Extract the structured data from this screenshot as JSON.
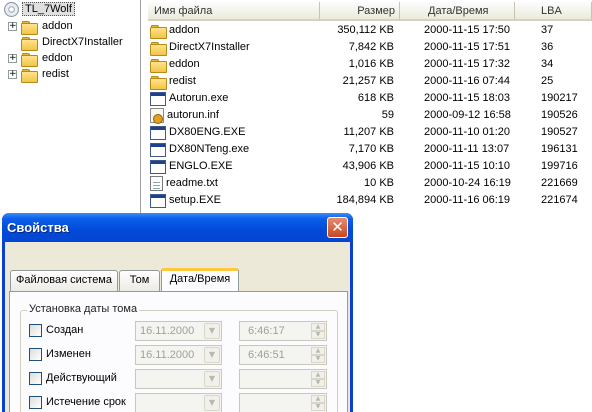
{
  "tree": {
    "root": "TL_7Wolf",
    "items": [
      {
        "label": "addon",
        "expandable": true
      },
      {
        "label": "DirectX7Installer",
        "expandable": false
      },
      {
        "label": "eddon",
        "expandable": true
      },
      {
        "label": "redist",
        "expandable": true
      }
    ],
    "expander_glyph": "+"
  },
  "list": {
    "columns": {
      "name": "Имя файла",
      "size": "Размер",
      "date": "Дата/Время",
      "lba": "LBA"
    },
    "rows": [
      {
        "icon": "folder-icon",
        "name": "addon",
        "size": "350,112 KB",
        "date": "2000-11-15 17:50",
        "lba": "37"
      },
      {
        "icon": "folder-icon",
        "name": "DirectX7Installer",
        "size": "7,842 KB",
        "date": "2000-11-15 17:51",
        "lba": "36"
      },
      {
        "icon": "folder-icon",
        "name": "eddon",
        "size": "1,016 KB",
        "date": "2000-11-15 17:32",
        "lba": "34"
      },
      {
        "icon": "folder-icon",
        "name": "redist",
        "size": "21,257 KB",
        "date": "2000-11-16 07:44",
        "lba": "25"
      },
      {
        "icon": "exe-icon",
        "name": "Autorun.exe",
        "size": "618 KB",
        "date": "2000-11-15 18:03",
        "lba": "190217"
      },
      {
        "icon": "inf-icon",
        "name": "autorun.inf",
        "size": "59",
        "date": "2000-09-12 16:58",
        "lba": "190526"
      },
      {
        "icon": "exe-icon",
        "name": "DX80ENG.EXE",
        "size": "11,207 KB",
        "date": "2000-11-10 01:20",
        "lba": "190527"
      },
      {
        "icon": "exe-icon",
        "name": "DX80NTeng.exe",
        "size": "7,170 KB",
        "date": "2000-11-11 13:07",
        "lba": "196131"
      },
      {
        "icon": "exe-icon",
        "name": "ENGLO.EXE",
        "size": "43,906 KB",
        "date": "2000-11-15 10:10",
        "lba": "199716"
      },
      {
        "icon": "txt-icon",
        "name": "readme.txt",
        "size": "10 KB",
        "date": "2000-10-24 16:19",
        "lba": "221669"
      },
      {
        "icon": "exe-icon",
        "name": "setup.EXE",
        "size": "184,894 KB",
        "date": "2000-11-16 06:19",
        "lba": "221674"
      }
    ]
  },
  "dialog": {
    "title": "Свойства",
    "close_glyph": "✕",
    "tabs": [
      {
        "label": "Файловая система",
        "active": false
      },
      {
        "label": "Том",
        "active": false
      },
      {
        "label": "Дата/Время",
        "active": true
      }
    ],
    "group_title": "Установка даты тома",
    "fields": [
      {
        "label": "Создан",
        "date": "16.11.2000",
        "time": "6:46:17"
      },
      {
        "label": "Изменен",
        "date": "16.11.2000",
        "time": "6:46:51"
      },
      {
        "label": "Действующий",
        "date": "",
        "time": ""
      },
      {
        "label": "Истечение срок",
        "date": "",
        "time": ""
      }
    ],
    "dropdown_glyph": "▼",
    "spin_up_glyph": "▲",
    "spin_down_glyph": "▼"
  }
}
